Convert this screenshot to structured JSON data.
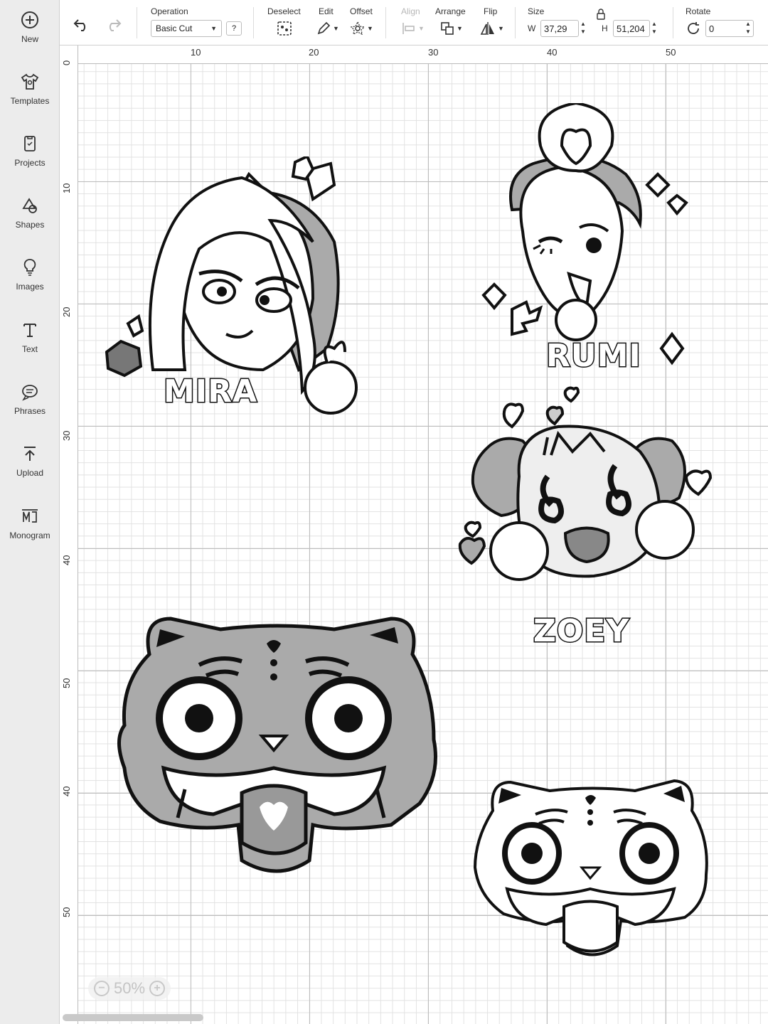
{
  "sidebar": {
    "items": [
      {
        "label": "New",
        "icon": "plus-circle-icon"
      },
      {
        "label": "Templates",
        "icon": "tshirt-icon"
      },
      {
        "label": "Projects",
        "icon": "projects-icon"
      },
      {
        "label": "Shapes",
        "icon": "shapes-icon"
      },
      {
        "label": "Images",
        "icon": "lightbulb-icon"
      },
      {
        "label": "Text",
        "icon": "text-icon"
      },
      {
        "label": "Phrases",
        "icon": "speech-bubble-icon"
      },
      {
        "label": "Upload",
        "icon": "upload-icon"
      },
      {
        "label": "Monogram",
        "icon": "monogram-icon"
      }
    ]
  },
  "toolbar": {
    "operation_label": "Operation",
    "operation_value": "Basic Cut",
    "help_label": "?",
    "deselect_label": "Deselect",
    "edit_label": "Edit",
    "offset_label": "Offset",
    "align_label": "Align",
    "arrange_label": "Arrange",
    "flip_label": "Flip",
    "size_label": "Size",
    "width_prefix": "W",
    "width_value": "37,29",
    "height_prefix": "H",
    "height_value": "51,204",
    "rotate_label": "Rotate",
    "rotate_value": "0"
  },
  "ruler_top": [
    "10",
    "20",
    "30",
    "40",
    "50"
  ],
  "ruler_left": [
    "0",
    "10",
    "20",
    "30",
    "40",
    "50",
    "40",
    "50"
  ],
  "stickers": {
    "mira": "MIRA",
    "rumi": "RUMI",
    "zoey": "ZOEY"
  },
  "zoom": {
    "value": "50%",
    "minus": "−",
    "plus": "+"
  }
}
